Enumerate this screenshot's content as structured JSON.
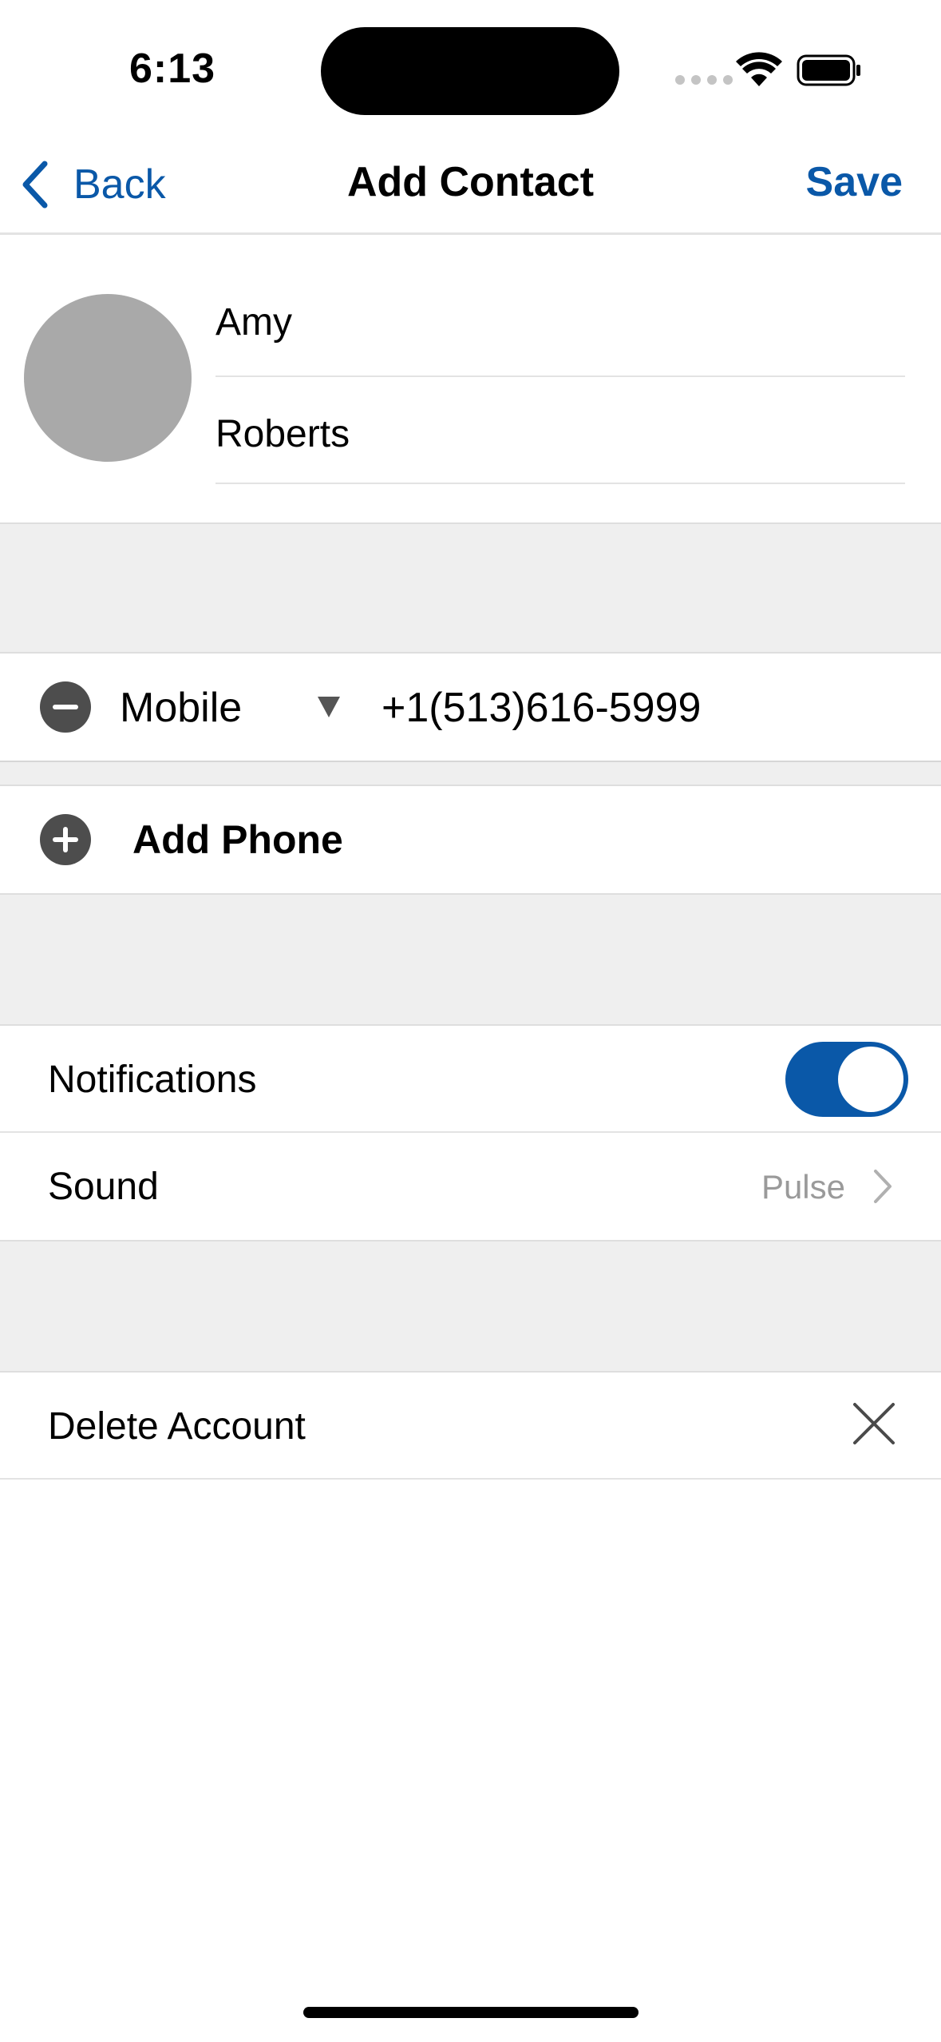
{
  "status_bar": {
    "time": "6:13"
  },
  "nav": {
    "back_label": "Back",
    "title": "Add Contact",
    "save_label": "Save"
  },
  "contact": {
    "first_name": "Amy",
    "last_name": "Roberts"
  },
  "phone": {
    "type": "Mobile",
    "number": "+1(513)616-5999",
    "add_label": "Add Phone"
  },
  "settings": {
    "notifications_label": "Notifications",
    "notifications_on": true,
    "sound_label": "Sound",
    "sound_value": "Pulse",
    "delete_label": "Delete Account"
  },
  "colors": {
    "accent": "#0a58a8",
    "section_gray": "#efefef",
    "avatar_gray": "#a9a9a9",
    "icon_dark": "#4d4d4d"
  },
  "icons": {
    "back": "chevron-left-icon",
    "dropdown": "triangle-down-icon",
    "remove": "minus-circle-icon",
    "add": "plus-circle-icon",
    "sound": "chevron-right-icon",
    "delete": "close-icon"
  }
}
